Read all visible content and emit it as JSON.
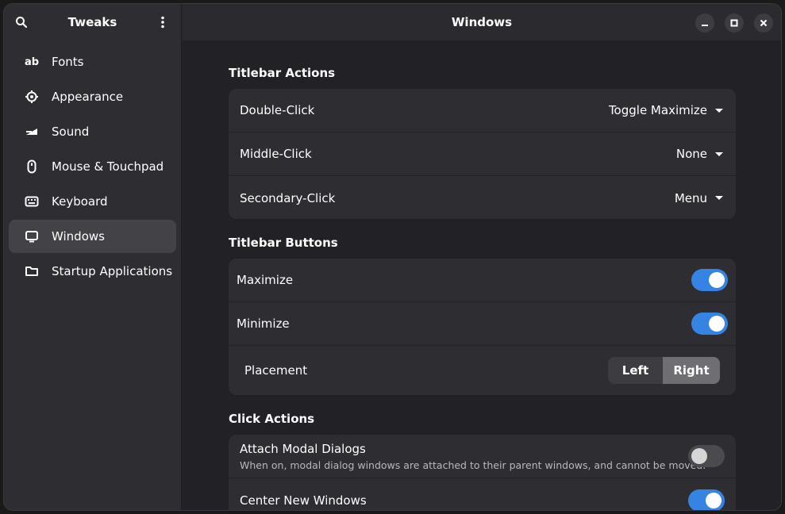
{
  "sidebar": {
    "title": "Tweaks",
    "items": [
      {
        "label": "Fonts",
        "icon": "fonts-icon"
      },
      {
        "label": "Appearance",
        "icon": "appearance-icon"
      },
      {
        "label": "Sound",
        "icon": "sound-icon"
      },
      {
        "label": "Mouse & Touchpad",
        "icon": "mouse-icon"
      },
      {
        "label": "Keyboard",
        "icon": "keyboard-icon"
      },
      {
        "label": "Windows",
        "icon": "windows-icon",
        "active": true
      },
      {
        "label": "Startup Applications",
        "icon": "folder-icon"
      }
    ]
  },
  "header": {
    "title": "Windows"
  },
  "titlebar_actions": {
    "title": "Titlebar Actions",
    "rows": [
      {
        "label": "Double-Click",
        "value": "Toggle Maximize"
      },
      {
        "label": "Middle-Click",
        "value": "None"
      },
      {
        "label": "Secondary-Click",
        "value": "Menu"
      }
    ]
  },
  "titlebar_buttons": {
    "title": "Titlebar Buttons",
    "maximize": {
      "label": "Maximize",
      "on": true
    },
    "minimize": {
      "label": "Minimize",
      "on": true
    },
    "placement": {
      "label": "Placement",
      "left": "Left",
      "right": "Right",
      "selected": "Right"
    }
  },
  "click_actions": {
    "title": "Click Actions",
    "attach_modal": {
      "label": "Attach Modal Dialogs",
      "description": "When on, modal dialog windows are attached to their parent windows, and cannot be moved.",
      "on": false
    },
    "center_new": {
      "label": "Center New Windows",
      "on": true
    }
  },
  "colors": {
    "accent": "#3584e4",
    "background": "#222226",
    "sidebar": "#2e2e32"
  }
}
